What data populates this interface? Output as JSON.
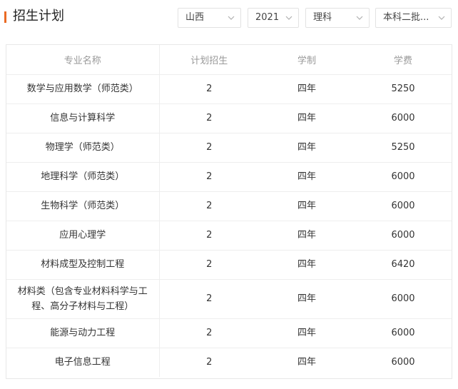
{
  "header": {
    "title": "招生计划",
    "filters": {
      "province": "山西",
      "year": "2021",
      "subject": "理科",
      "batch": "本科二批..."
    }
  },
  "colors": {
    "accent": "#ea6a24"
  },
  "table": {
    "headers": [
      "专业名称",
      "计划招生",
      "学制",
      "学费"
    ],
    "rows": [
      [
        "数学与应用数学（师范类）",
        "2",
        "四年",
        "5250"
      ],
      [
        "信息与计算科学",
        "2",
        "四年",
        "6000"
      ],
      [
        "物理学（师范类）",
        "2",
        "四年",
        "5250"
      ],
      [
        "地理科学（师范类）",
        "2",
        "四年",
        "6000"
      ],
      [
        "生物科学（师范类）",
        "2",
        "四年",
        "6000"
      ],
      [
        "应用心理学",
        "2",
        "四年",
        "6000"
      ],
      [
        "材料成型及控制工程",
        "2",
        "四年",
        "6420"
      ],
      [
        "材料类（包含专业材料科学与工程、高分子材料与工程）",
        "2",
        "四年",
        "6000"
      ],
      [
        "能源与动力工程",
        "2",
        "四年",
        "6000"
      ],
      [
        "电子信息工程",
        "2",
        "四年",
        "6000"
      ]
    ]
  }
}
